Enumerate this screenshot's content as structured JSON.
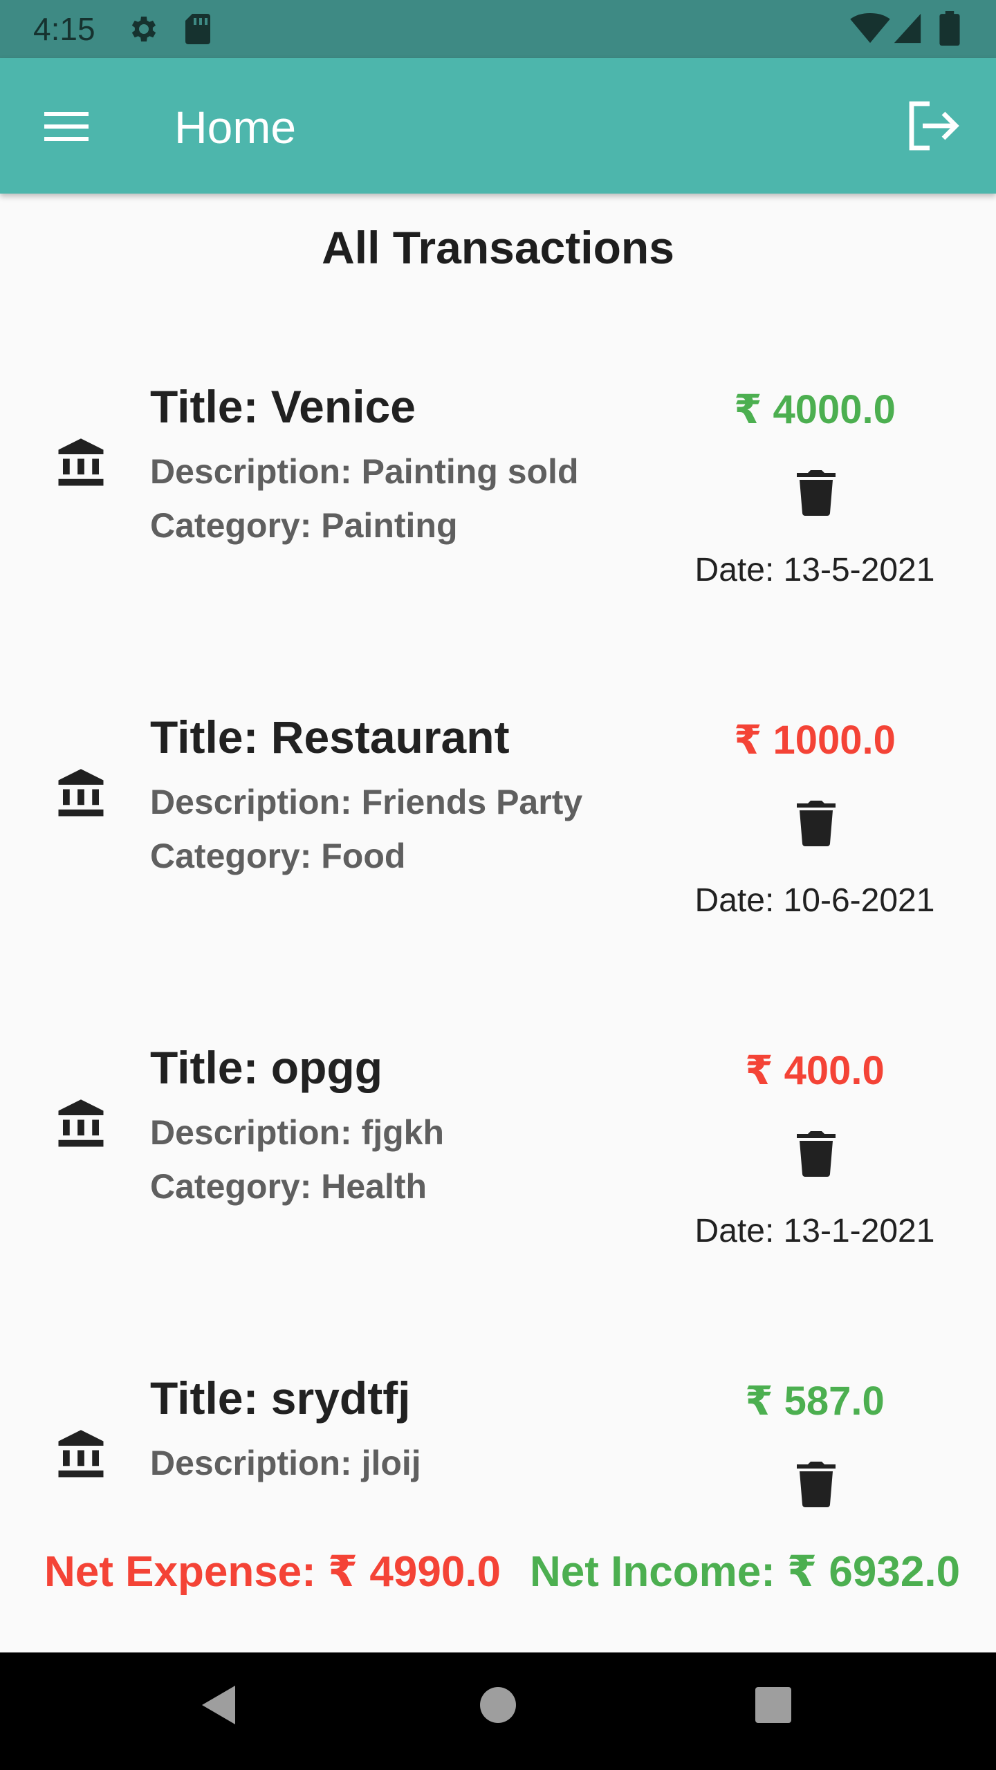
{
  "status_bar": {
    "time": "4:15",
    "icons": [
      "gear-icon",
      "sd-card-icon",
      "wifi-icon",
      "cell-signal-icon",
      "battery-icon"
    ]
  },
  "app_bar": {
    "title": "Home",
    "menu_icon": "menu-icon",
    "logout_icon": "logout-icon",
    "background": "#4db6ac"
  },
  "main": {
    "heading": "All Transactions",
    "transactions": [
      {
        "title": "Title: Venice",
        "description": "Description: Painting sold",
        "category": "Category: Painting",
        "amount": "₹ 4000.0",
        "date": "Date: 13-5-2021",
        "type": "income",
        "color": "#4caf50"
      },
      {
        "title": "Title: Restaurant",
        "description": "Description: Friends Party",
        "category": "Category: Food",
        "amount": "₹ 1000.0",
        "date": "Date: 10-6-2021",
        "type": "expense",
        "color": "#f44336"
      },
      {
        "title": "Title: opgg",
        "description": "Description: fjgkh",
        "category": "Category: Health",
        "amount": "₹ 400.0",
        "date": "Date: 13-1-2021",
        "type": "expense",
        "color": "#f44336"
      },
      {
        "title": "Title: srydtfj",
        "description": "Description: jloij",
        "category": "",
        "amount": "₹ 587.0",
        "date": "",
        "type": "income",
        "color": "#4caf50"
      }
    ]
  },
  "totals": {
    "net_expense": "Net Expense: ₹ 4990.0",
    "net_income": "Net Income: ₹ 6932.0",
    "expense_color": "#f44336",
    "income_color": "#4caf50"
  },
  "nav_bar": {
    "icons": [
      "back-icon",
      "home-icon",
      "recents-icon"
    ]
  }
}
